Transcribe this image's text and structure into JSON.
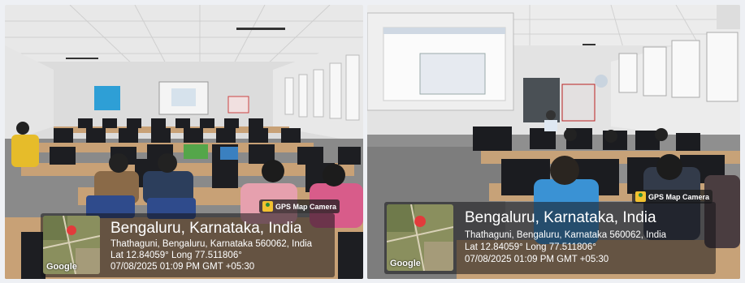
{
  "photos": [
    {
      "gps_badge": "GPS Map Camera",
      "location_title": "Bengaluru, Karnataka, India",
      "address": "Thathaguni, Bengaluru, Karnataka 560062, India",
      "coordinates": "Lat 12.84059° Long 77.511806°",
      "datetime": "07/08/2025 01:09 PM GMT +05:30",
      "map_label": "Google"
    },
    {
      "gps_badge": "GPS Map Camera",
      "location_title": "Bengaluru, Karnataka, India",
      "address": "Thathaguni, Bengaluru, Karnataka 560062, India",
      "coordinates": "Lat 12.84059° Long 77.511806°",
      "datetime": "07/08/2025 01:09 PM GMT +05:30",
      "map_label": "Google"
    }
  ],
  "colors": {
    "ceiling": "#e6e6e6",
    "wall": "#dedede",
    "floor": "#8c8c8c",
    "desk": "#c9a57c",
    "monitor": "#1c1d22",
    "map_pin": "#e23b3b"
  }
}
